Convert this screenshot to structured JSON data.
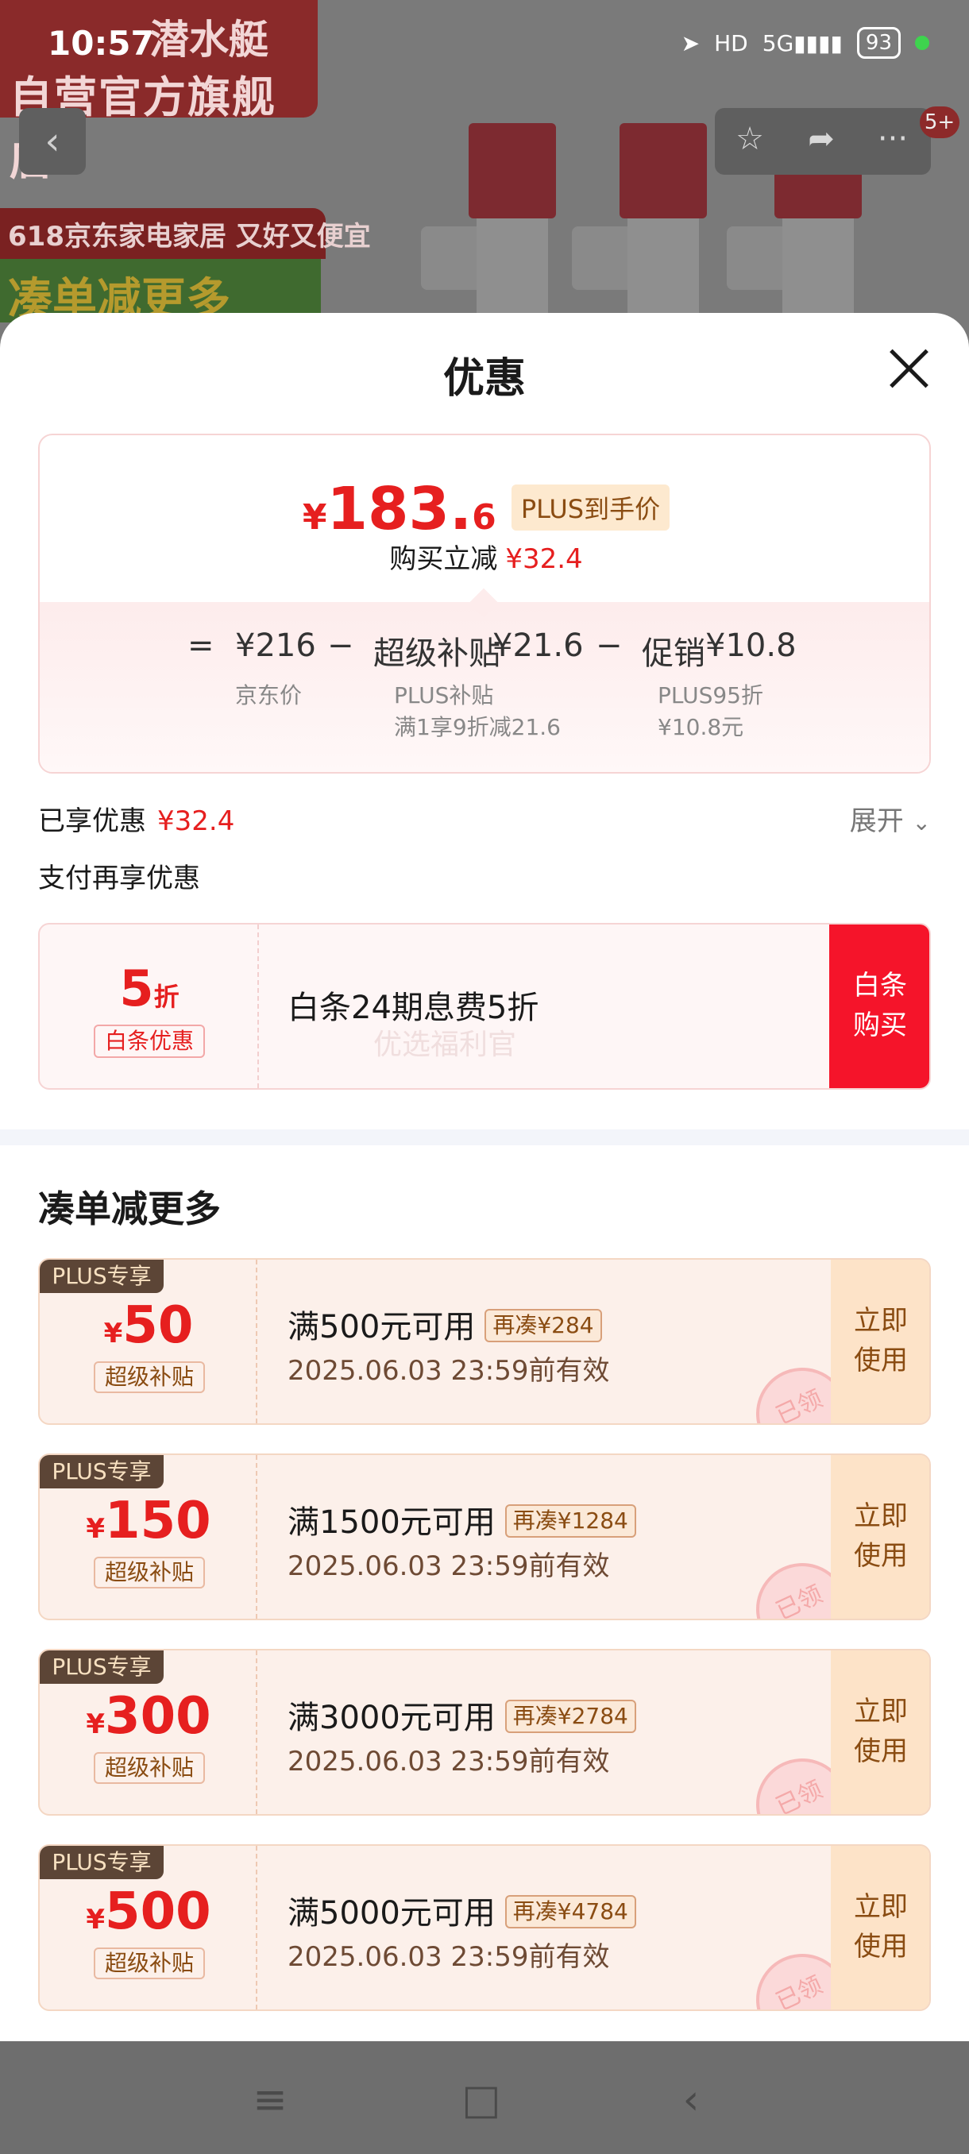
{
  "status_bar": {
    "time": "10:57",
    "network": "5G",
    "hd": "HD",
    "battery": "93"
  },
  "background": {
    "brand": "潜水艇",
    "store_name": "自营官方旗舰店",
    "badge_618": "618京东家电家居 又好又便宜",
    "promo": "凑单减更多",
    "cart_count": "5+"
  },
  "sheet": {
    "title": "优惠"
  },
  "price_card": {
    "yen": "¥",
    "price_int": "183.",
    "price_dec": "6",
    "plus_tag": "PLUS到手价",
    "save_label": "购买立减",
    "save_value": "¥32.4",
    "formula": {
      "equals": "=",
      "jd_price": "¥216",
      "minus1": "−",
      "subsidy_label": "超级补贴",
      "subsidy_value": "¥21.6",
      "minus2": "−",
      "promo_label": "促销",
      "promo_value": "¥10.8"
    },
    "notes": {
      "jd_price_label": "京东价",
      "subsidy_note_1": "PLUS补贴",
      "subsidy_note_2": "满1享9折减21.6",
      "promo_note_1": "PLUS95折",
      "promo_note_2": "¥10.8元"
    }
  },
  "enjoyed": {
    "label": "已享优惠",
    "value": "¥32.4",
    "expand_label": "展开"
  },
  "pay_more": {
    "label": "支付再享优惠"
  },
  "baitiao": {
    "discount_number": "5",
    "discount_unit": "折",
    "tag": "白条优惠",
    "text": "白条24期息费5折",
    "watermark": "优选福利官",
    "button_line1": "白条",
    "button_line2": "购买"
  },
  "more_section": {
    "title": "凑单减更多",
    "coupons": [
      {
        "plus_label": "PLUS专享",
        "yen": "¥",
        "amount": "50",
        "tag": "超级补贴",
        "condition": "满500元可用",
        "more": "再凑¥284",
        "valid": "2025.06.03 23:59前有效",
        "btn1": "立即",
        "btn2": "使用",
        "stamp": "已领"
      },
      {
        "plus_label": "PLUS专享",
        "yen": "¥",
        "amount": "150",
        "tag": "超级补贴",
        "condition": "满1500元可用",
        "more": "再凑¥1284",
        "valid": "2025.06.03 23:59前有效",
        "btn1": "立即",
        "btn2": "使用",
        "stamp": "已领"
      },
      {
        "plus_label": "PLUS专享",
        "yen": "¥",
        "amount": "300",
        "tag": "超级补贴",
        "condition": "满3000元可用",
        "more": "再凑¥2784",
        "valid": "2025.06.03 23:59前有效",
        "btn1": "立即",
        "btn2": "使用",
        "stamp": "已领"
      },
      {
        "plus_label": "PLUS专享",
        "yen": "¥",
        "amount": "500",
        "tag": "超级补贴",
        "condition": "满5000元可用",
        "more": "再凑¥4784",
        "valid": "2025.06.03 23:59前有效",
        "btn1": "立即",
        "btn2": "使用",
        "stamp": "已领"
      }
    ]
  },
  "navbar": {
    "menu_icon": "≡",
    "home_icon": "□",
    "back_icon": "‹"
  },
  "colors": {
    "accent_red": "#e61f1f",
    "baitiao_button": "#f5142a",
    "coupon_bg": "#fcf0ea",
    "plus_badge_bg": "#5c4536"
  },
  "icons": [
    "back-icon",
    "star-icon",
    "share-icon",
    "more-icon",
    "close-icon",
    "chevron-down-icon",
    "menu-icon",
    "home-icon",
    "nav-back-icon",
    "location-icon",
    "signal-icon"
  ]
}
